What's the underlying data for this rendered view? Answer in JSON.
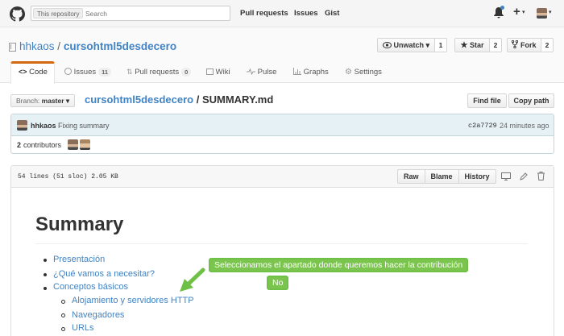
{
  "header": {
    "search_scope": "This repository",
    "search_placeholder": "Search",
    "nav": [
      "Pull requests",
      "Issues",
      "Gist"
    ],
    "plus_label": "+",
    "caret": "▾"
  },
  "repo": {
    "owner": "hhkaos",
    "separator": " / ",
    "name": "cursohtml5desdecero",
    "watch_label": "Unwatch ▾",
    "watch_count": "1",
    "star_label": "Star",
    "star_count": "2",
    "fork_label": "Fork",
    "fork_count": "2"
  },
  "tabs": [
    {
      "label": "Code",
      "count": "",
      "icon": "code-icon"
    },
    {
      "label": "Issues",
      "count": "11",
      "icon": "issue-icon"
    },
    {
      "label": "Pull requests",
      "count": "0",
      "icon": "pull-request-icon"
    },
    {
      "label": "Wiki",
      "count": "",
      "icon": "book-icon"
    },
    {
      "label": "Pulse",
      "count": "",
      "icon": "pulse-icon"
    },
    {
      "label": "Graphs",
      "count": "",
      "icon": "graph-icon"
    },
    {
      "label": "Settings",
      "count": "",
      "icon": "gear-icon"
    }
  ],
  "file_nav": {
    "branch_prefix": "Branch:",
    "branch_name": "master ▾",
    "crumb_repo": "cursohtml5desdecero",
    "crumb_sep": " / ",
    "crumb_file": "SUMMARY.md",
    "find_file": "Find file",
    "copy_path": "Copy path"
  },
  "commit": {
    "author": "hhkaos",
    "message": "Fixing summary",
    "sha": "c2a7729",
    "time": "24 minutes ago",
    "contributors_count": "2",
    "contributors_label": "contributors"
  },
  "file": {
    "info": "54 lines (51 sloc)   2.05 KB",
    "raw": "Raw",
    "blame": "Blame",
    "history": "History"
  },
  "content": {
    "heading": "Summary",
    "items": [
      "Presentación",
      "¿Qué vamos a necesitar?",
      "Conceptos básicos"
    ],
    "subitems": [
      "Alojamiento y servidores HTTP",
      "Navegadores",
      "URLs"
    ]
  },
  "annotations": {
    "callout_main": "Seleccionamos el apartado donde queremos hacer la contribución",
    "callout_no": "No",
    "color": "#7bc54f"
  },
  "colors": {
    "link": "#4183c4",
    "accent_tab": "#d26911",
    "commit_bg": "#e6f1f6"
  }
}
